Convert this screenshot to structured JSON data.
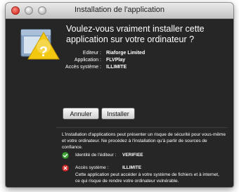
{
  "window": {
    "title": "Installation de l'application"
  },
  "dialog": {
    "heading": "Voulez-vous vraiment installer cette application sur votre ordinateur ?",
    "details": [
      {
        "label": "Editeur :",
        "value": "Riaforge Limited"
      },
      {
        "label": "Application :",
        "value": "FLVPlay"
      },
      {
        "label": "Accès système :",
        "value": "ILLIMITE"
      }
    ]
  },
  "buttons": {
    "cancel": "Annuler",
    "install": "Installer"
  },
  "warning": {
    "text": "L'installation d'applications peut présenter un risque de sécurité pour vous-même et votre ordinateur. Ne procédez à l'installation qu'à partir de sources de confiance.",
    "publisher_label": "Identité de l'éditeur :",
    "publisher_value": "VERIFIEE",
    "access_label": "Accès système :",
    "access_value": "ILLIMITE",
    "access_note": "Cette application peut accéder à votre système de fichiers et à internet, ce qui risque de rendre votre ordinateur vulnérable."
  },
  "icons": {
    "dialog": "folder-question-icon",
    "publisher_status": "check-icon",
    "access_status": "x-icon"
  },
  "colors": {
    "window_bg": "#262626",
    "check": "#3fa535",
    "x": "#d22b2b",
    "warning_triangle": "#f2c811"
  }
}
